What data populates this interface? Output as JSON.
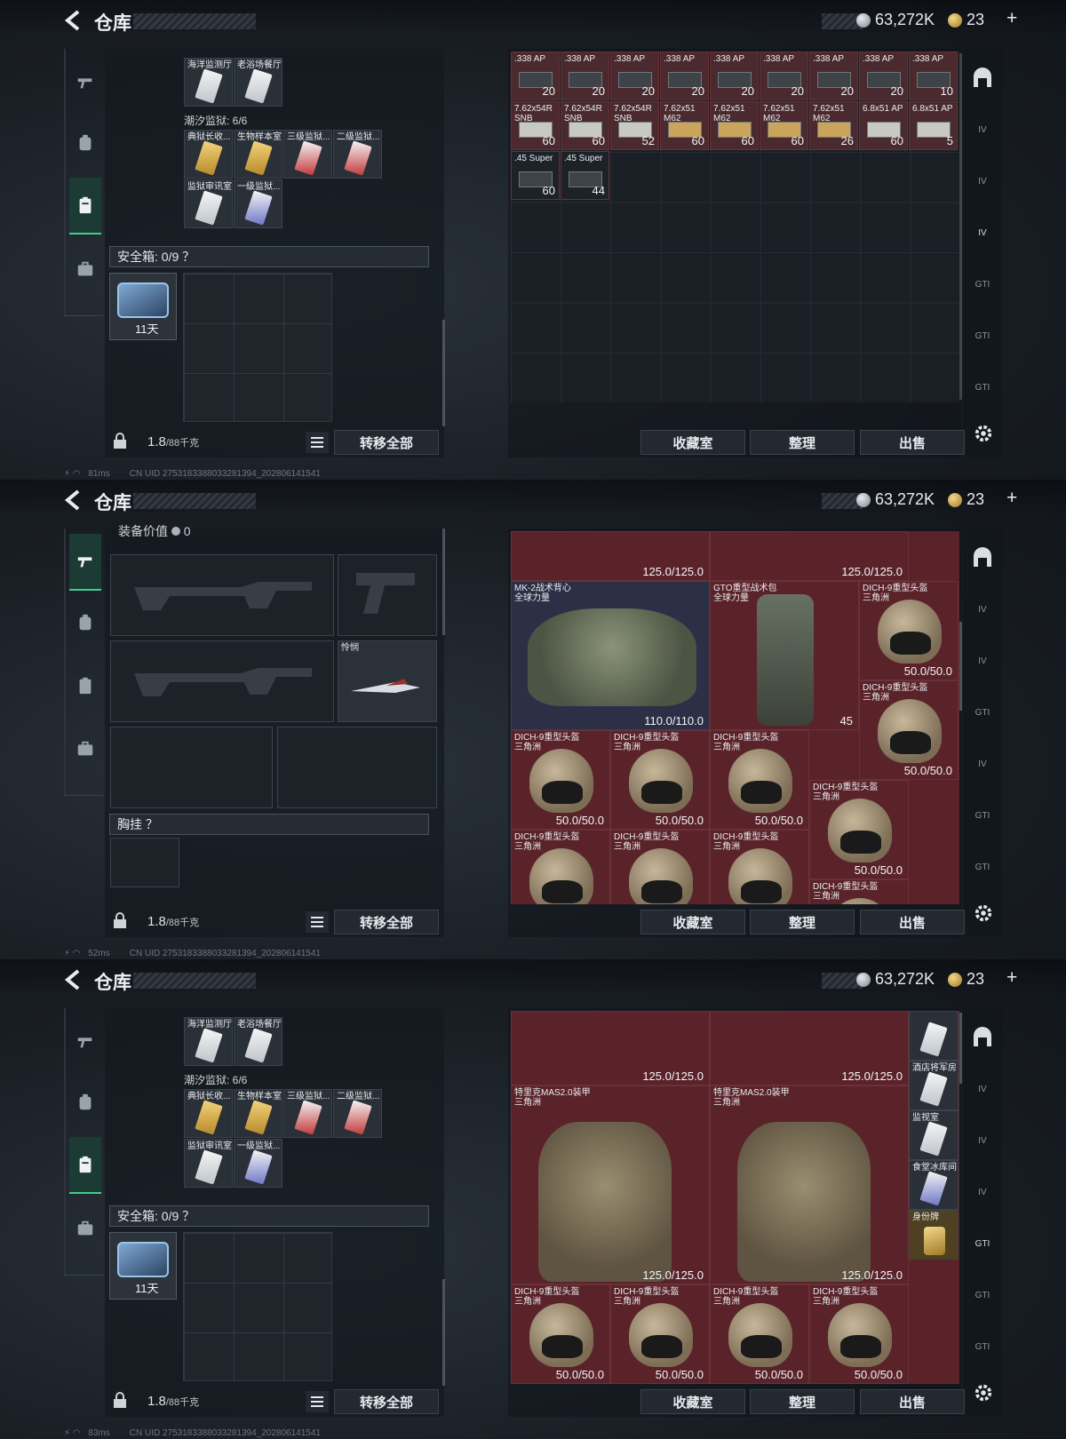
{
  "header": {
    "title": "仓库",
    "silver": "63,272K",
    "gold": "23",
    "plus": "+"
  },
  "status": {
    "ping1": "81ms",
    "ping2": "52ms",
    "ping3": "83ms",
    "uid": "CN UID 2753183388033281394_202806141541"
  },
  "bottom": {
    "weight": "1.8",
    "weight_unit": "/88千克",
    "transfer": "转移全部",
    "collect": "收藏室",
    "sort": "整理",
    "sell": "出售"
  },
  "panel1": {
    "keys_top": [
      "海洋监测厅",
      "老浴场餐厅"
    ],
    "prison_label": "潮汐监狱: 6/6",
    "keys_prison": [
      "典狱长收...",
      "生物样本室",
      "三级监狱...",
      "二级监狱...",
      "监狱审讯室",
      "一级监狱..."
    ],
    "safebox": "安全箱: 0/9 ？",
    "case_timer": "11天",
    "ammo_row1": [
      ".338 AP",
      ".338 AP",
      ".338 AP",
      ".338 AP",
      ".338 AP",
      ".338 AP",
      ".338 AP",
      ".338 AP",
      ".338 AP"
    ],
    "ammo_row1_counts": [
      "20",
      "20",
      "20",
      "20",
      "20",
      "20",
      "20",
      "20",
      "10"
    ],
    "ammo_row2": [
      "7.62x54R SNB",
      "7.62x54R SNB",
      "7.62x54R SNB",
      "7.62x51 M62",
      "7.62x51 M62",
      "7.62x51 M62",
      "7.62x51 M62",
      "6.8x51 AP",
      "6.8x51 AP"
    ],
    "ammo_row2_counts": [
      "60",
      "60",
      "52",
      "60",
      "60",
      "60",
      "26",
      "60",
      "5"
    ],
    "ammo_row3": [
      ".45 Super",
      ".45 Super"
    ],
    "ammo_row3_counts": [
      "60",
      "44"
    ]
  },
  "panel2": {
    "gear_value_label": "装备价值",
    "gear_value": "0",
    "knife": "怜悯",
    "chest_rig": "胸挂 ？",
    "top_hp1": "125.0/125.0",
    "top_hp2": "125.0/125.0",
    "vest_name": "MK-2战术背心",
    "vest_sub": "全球力量",
    "vest_hp": "110.0/110.0",
    "pack_name": "GTO重型战术包",
    "pack_sub": "全球力量",
    "pack_count": "45",
    "helmet_name": "DICH-9重型头盔",
    "helmet_sub": "三角洲",
    "helmet_hp": "50.0/50.0"
  },
  "panel3": {
    "armor_name": "特里克MAS2.0装甲",
    "armor_sub": "三角洲",
    "armor_hp": "125.0/125.0",
    "side_keys": [
      "酒店将军房",
      "监视室",
      "食堂冰库间",
      "身份牌"
    ]
  },
  "rail_labels": [
    "IV",
    "IV",
    "IV",
    "GTI",
    "GTI",
    "GTI"
  ]
}
